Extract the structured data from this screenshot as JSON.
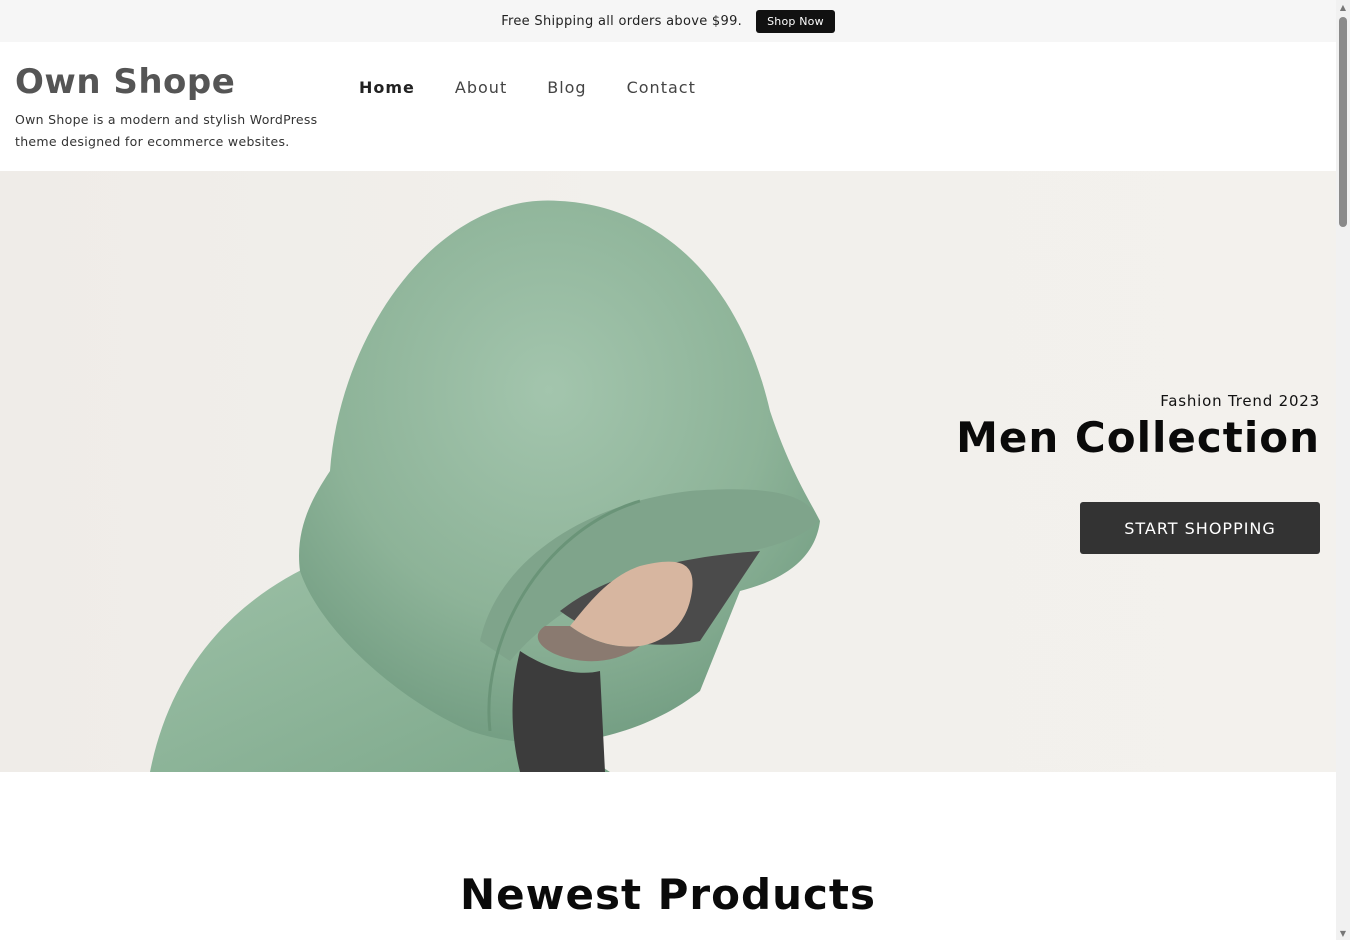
{
  "topbar": {
    "text": "Free Shipping all orders above $99.",
    "button_label": "Shop Now"
  },
  "header": {
    "logo": "Own Shope",
    "tagline": "Own Shope is a modern and stylish WordPress theme designed for ecommerce websites.",
    "nav": [
      {
        "label": "Home"
      },
      {
        "label": "About"
      },
      {
        "label": "Blog"
      },
      {
        "label": "Contact"
      }
    ]
  },
  "hero": {
    "subtitle": "Fashion Trend 2023",
    "title": "Men Collection",
    "button_label": "START SHOPPING"
  },
  "section": {
    "title": "Newest Products"
  },
  "scrollbar": {
    "up_icon": "▲",
    "down_icon": "▼"
  },
  "colors": {
    "topbar_bg": "#f6f6f6",
    "hero_bg": "#f2f0ec",
    "button_dark": "#333333",
    "hoodie_green": "#8fb49a"
  }
}
